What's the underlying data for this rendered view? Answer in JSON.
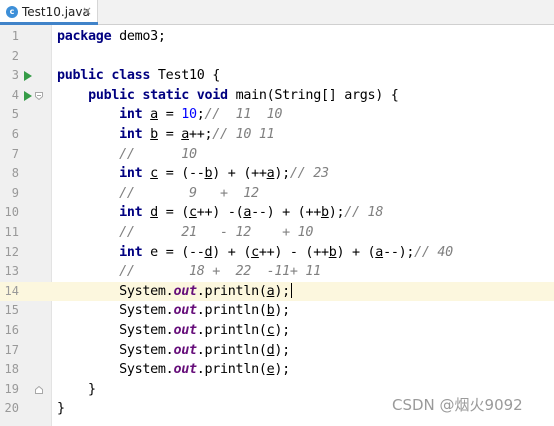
{
  "tab": {
    "icon": "c",
    "filename": "Test10.java",
    "close": "×"
  },
  "line_numbers": [
    "1",
    "2",
    "3",
    "4",
    "5",
    "6",
    "7",
    "8",
    "9",
    "10",
    "11",
    "12",
    "13",
    "14",
    "15",
    "16",
    "17",
    "18",
    "19",
    "20"
  ],
  "code": {
    "l1": [
      "package",
      " demo3;"
    ],
    "l3": [
      "public",
      " ",
      "class",
      " Test10 {"
    ],
    "l4": [
      "    ",
      "public",
      " ",
      "static",
      " ",
      "void",
      " main(String[] args) {"
    ],
    "l5": [
      "        ",
      "int",
      " ",
      "a",
      " = ",
      "10",
      ";",
      "//  11  10"
    ],
    "l6": [
      "        ",
      "int",
      " ",
      "b",
      " = ",
      "a",
      "++;",
      "// 10 11"
    ],
    "l7": [
      "        ",
      "//      10"
    ],
    "l8": [
      "        ",
      "int",
      " ",
      "c",
      " = (--",
      "b",
      ") + (++",
      "a",
      ");",
      "// 23"
    ],
    "l9": [
      "        ",
      "//       9   +  12"
    ],
    "l10": [
      "        ",
      "int",
      " ",
      "d",
      " = (",
      "c",
      "++) -(",
      "a",
      "--) + (++",
      "b",
      ");",
      "// 18"
    ],
    "l11": [
      "        ",
      "//      21   - 12    + 10"
    ],
    "l12": [
      "        ",
      "int",
      " e = (--",
      "d",
      ") + (",
      "c",
      "++) - (++",
      "b",
      ") + (",
      "a",
      "--);",
      "// 40"
    ],
    "l13": [
      "        ",
      "//       18 +  22  -11+ 11"
    ],
    "l14": [
      "        ",
      "System.",
      "out",
      ".println(",
      "a",
      ");"
    ],
    "l15": [
      "        ",
      "System.",
      "out",
      ".println(",
      "b",
      ");"
    ],
    "l16": [
      "        ",
      "System.",
      "out",
      ".println(",
      "c",
      ");"
    ],
    "l17": [
      "        ",
      "System.",
      "out",
      ".println(",
      "d",
      ");"
    ],
    "l18": [
      "        ",
      "System.",
      "out",
      ".println(",
      "e",
      ");"
    ],
    "l19": [
      "    }"
    ],
    "l20": [
      "}"
    ]
  },
  "watermark": "CSDN @烟火9092",
  "colors": {
    "keyword": "#000080",
    "number": "#0000ff",
    "comment": "#808080",
    "static_field": "#660e7a",
    "current_line": "#fcf7de",
    "run_icon": "#359c47"
  },
  "icons": {
    "run_gutter": "run-icon",
    "fold": "fold-icon",
    "file": "java-class-icon"
  }
}
